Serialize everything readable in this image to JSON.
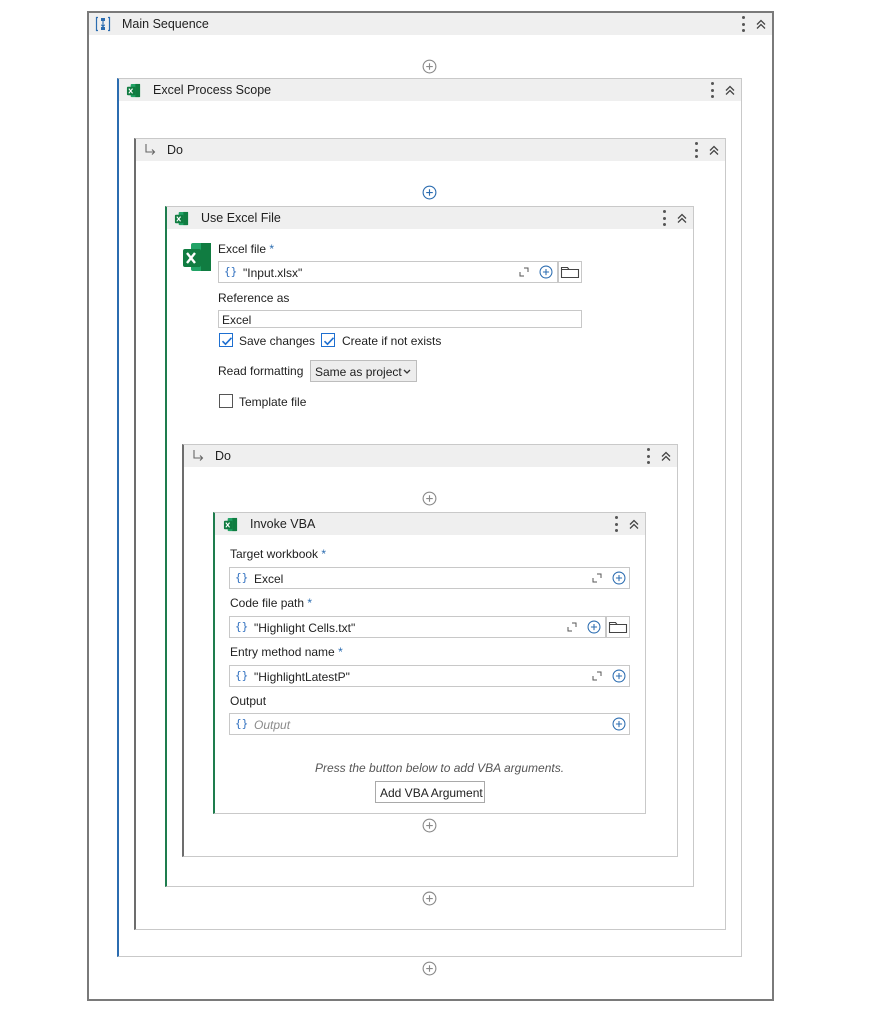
{
  "main_sequence": {
    "title": "Main Sequence"
  },
  "excel_process_scope": {
    "title": "Excel Process Scope"
  },
  "do_outer": {
    "title": "Do"
  },
  "use_excel_file": {
    "title": "Use Excel File",
    "excel_file_label": "Excel file",
    "required_mark": "*",
    "excel_file_value": "\"Input.xlsx\"",
    "reference_as_label": "Reference as",
    "reference_as_value": "Excel",
    "save_changes_label": "Save changes",
    "save_changes_checked": true,
    "create_if_not_exists_label": "Create if not exists",
    "create_if_not_exists_checked": true,
    "read_formatting_label": "Read formatting",
    "read_formatting_value": "Same as project",
    "template_file_label": "Template file",
    "template_file_checked": false
  },
  "do_inner": {
    "title": "Do"
  },
  "invoke_vba": {
    "title": "Invoke VBA",
    "target_workbook_label": "Target workbook",
    "target_workbook_value": "Excel",
    "code_file_path_label": "Code file path",
    "code_file_path_value": "\"Highlight Cells.txt\"",
    "entry_method_name_label": "Entry method name",
    "entry_method_name_value": "\"HighlightLatestP\"",
    "output_label": "Output",
    "output_placeholder": "Output",
    "hint": "Press the button below to add VBA arguments.",
    "add_argument_button": "Add VBA Argument",
    "braces": "{}"
  },
  "colors": {
    "accent_blue": "#2b6cb0",
    "excel_green": "#1e7d4e",
    "header_gray": "#efefef"
  }
}
